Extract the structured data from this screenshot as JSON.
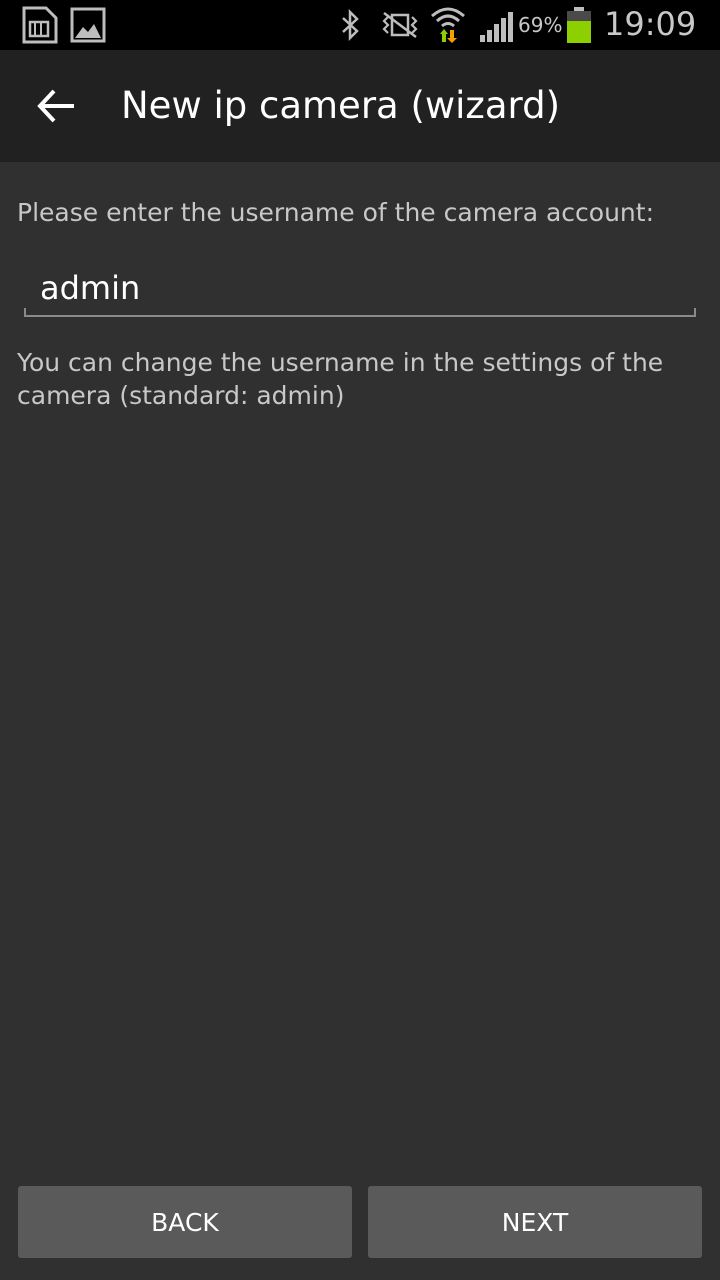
{
  "status_bar": {
    "battery_percent_text": "69%",
    "battery_level": 0.69,
    "time": "19:09",
    "icons": [
      "sim-card-icon",
      "gallery-icon",
      "bluetooth-icon",
      "vibrate-icon",
      "wifi-icon",
      "signal-icon",
      "battery-icon"
    ],
    "colors": {
      "battery_fill": "#8cd000",
      "wifi_up": "#f5a000",
      "wifi_down": "#8cd000"
    }
  },
  "app_bar": {
    "title": "New ip camera (wizard)",
    "back_icon": "arrow-back-icon"
  },
  "form": {
    "prompt": "Please enter the username of the camera account:",
    "username_value": "admin",
    "hint": "You can change the username in the settings of the camera (standard: admin)"
  },
  "buttons": {
    "back_label": "BACK",
    "next_label": "NEXT"
  }
}
